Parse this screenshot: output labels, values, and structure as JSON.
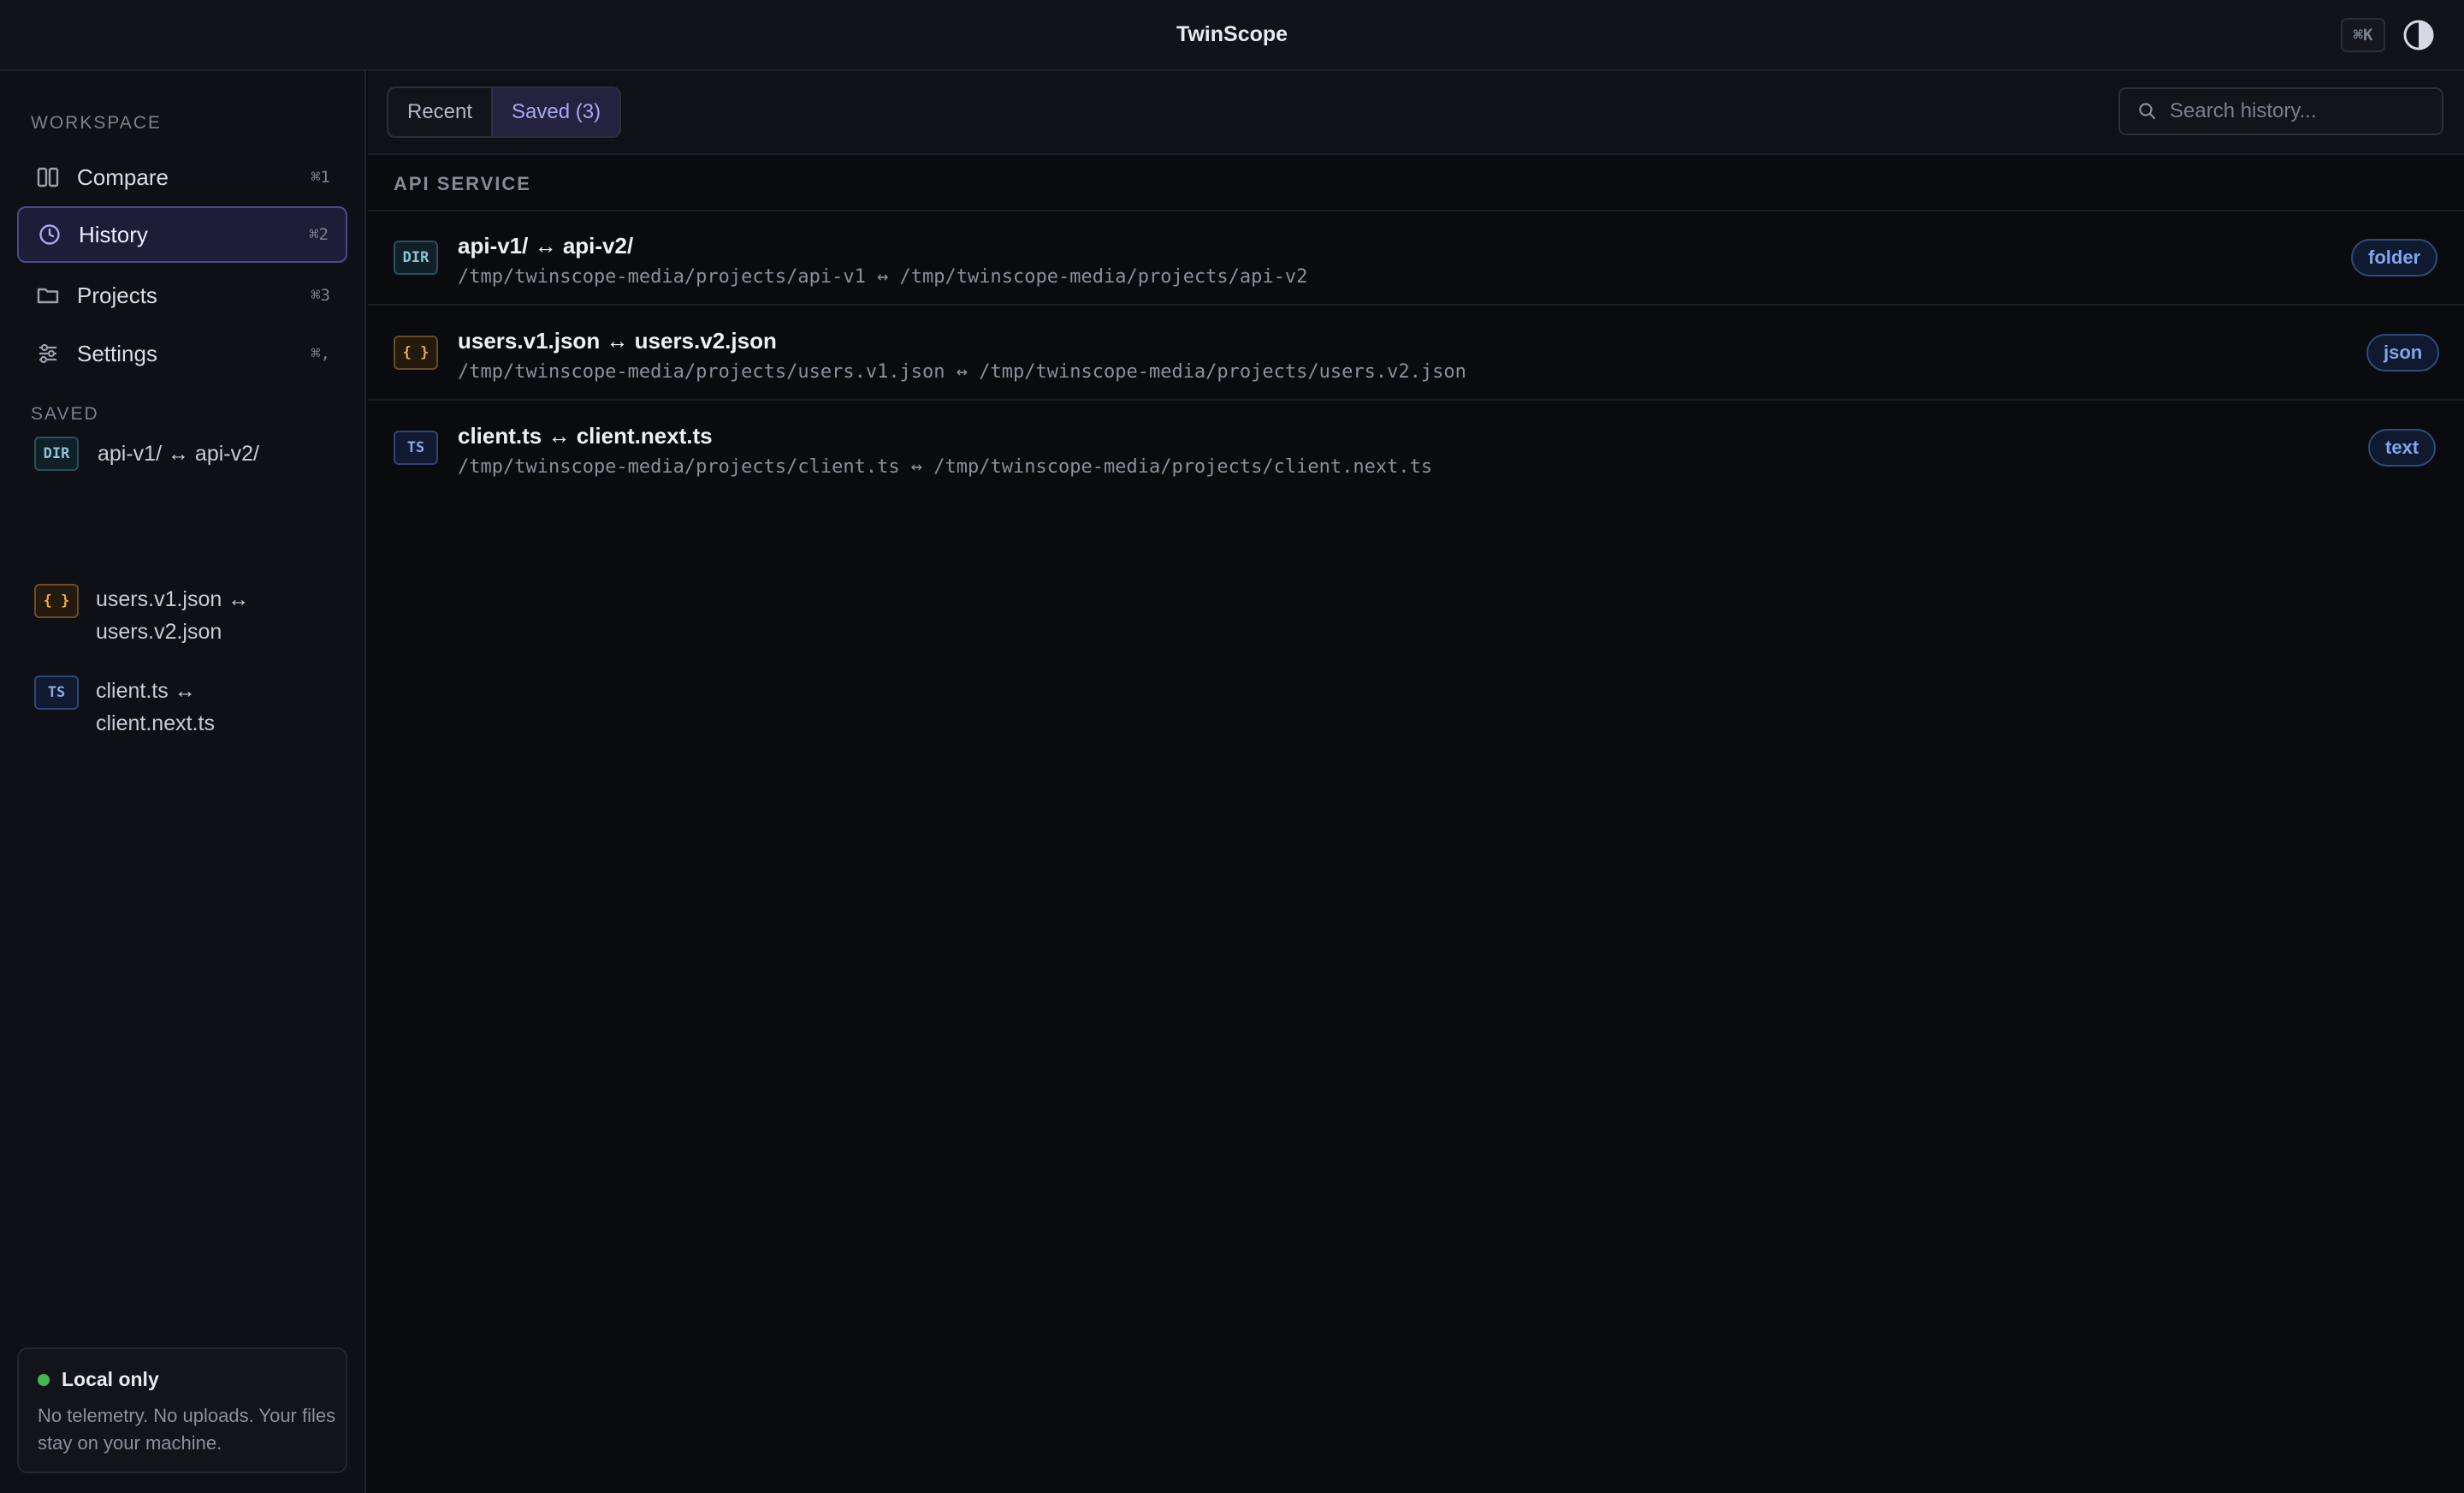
{
  "app": {
    "title": "TwinScope",
    "shortcut": "⌘K"
  },
  "sidebar": {
    "workspace_label": "WORKSPACE",
    "nav": [
      {
        "label": "Compare",
        "key": "⌘1",
        "icon": "columns-icon"
      },
      {
        "label": "History",
        "key": "⌘2",
        "icon": "clock-icon",
        "active": true
      },
      {
        "label": "Projects",
        "key": "⌘3",
        "icon": "folder-icon"
      },
      {
        "label": "Settings",
        "key": "⌘,",
        "icon": "sliders-icon"
      }
    ],
    "saved_label": "SAVED",
    "saved": [
      {
        "badge": "DIR",
        "label": "api-v1/ ↔ api-v2/"
      },
      {
        "badge": "{ }",
        "label": "users.v1.json ↔ users.v2.json"
      },
      {
        "badge": "TS",
        "label": "client.ts ↔ client.next.ts"
      }
    ],
    "local": {
      "title": "Local only",
      "description": "No telemetry. No uploads. Your files stay on your machine."
    }
  },
  "main": {
    "tabs": [
      {
        "label": "Recent"
      },
      {
        "label": "Saved (3)",
        "active": true
      }
    ],
    "search": {
      "placeholder": "Search history..."
    },
    "group_title": "API SERVICE",
    "rows": [
      {
        "badge": "DIR",
        "title": "api-v1/ ↔ api-v2/",
        "path": "/tmp/twinscope-media/projects/api-v1 ↔ /tmp/twinscope-media/projects/api-v2",
        "kind": "folder"
      },
      {
        "badge": "{ }",
        "title": "users.v1.json ↔ users.v2.json",
        "path": "/tmp/twinscope-media/projects/users.v1.json ↔ /tmp/twinscope-media/projects/users.v2.json",
        "kind": "json"
      },
      {
        "badge": "TS",
        "title": "client.ts ↔ client.next.ts",
        "path": "/tmp/twinscope-media/projects/client.ts ↔ /tmp/twinscope-media/projects/client.next.ts",
        "kind": "text"
      }
    ]
  },
  "colors": {
    "accent": "#4b4a8c",
    "status_ok": "#3fb950",
    "dir_badge": "#8cc4d8",
    "json_badge": "#e2a955",
    "ts_badge": "#8aa8e4"
  }
}
